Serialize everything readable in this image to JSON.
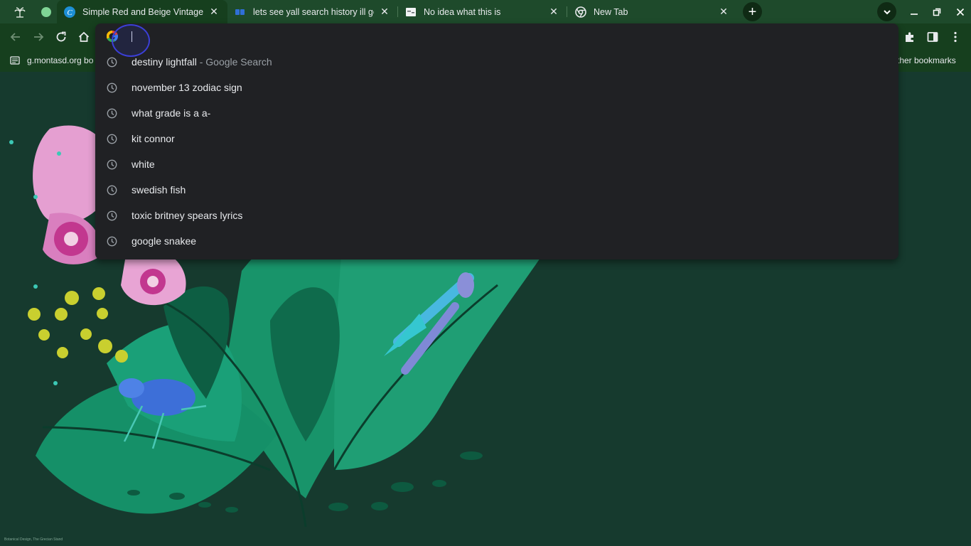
{
  "tabs": [
    {
      "title": "Simple Red and Beige Vintage Illustration",
      "active": true,
      "favicon": "canva-icon"
    },
    {
      "title": "lets see yall search history ill go",
      "active": false,
      "favicon": "doc-icon"
    },
    {
      "title": "No idea what this is",
      "active": false,
      "favicon": "page-icon"
    },
    {
      "title": "New Tab",
      "active": false,
      "favicon": "chrome-icon"
    }
  ],
  "tab_close_glyph": "✕",
  "new_tab_glyph": "+",
  "bookmarks": {
    "left_item": "g.montasd.org bo",
    "right_item": "ther bookmarks"
  },
  "omnibox": {
    "input_value": "",
    "suggestions": [
      {
        "text": "destiny lightfall",
        "sub": " - Google Search"
      },
      {
        "text": "november 13 zodiac sign",
        "sub": ""
      },
      {
        "text": "what grade is a a-",
        "sub": ""
      },
      {
        "text": "kit connor",
        "sub": ""
      },
      {
        "text": "white",
        "sub": ""
      },
      {
        "text": "swedish fish",
        "sub": ""
      },
      {
        "text": "toxic britney spears lyrics",
        "sub": ""
      },
      {
        "text": "google snakee",
        "sub": ""
      }
    ]
  },
  "colors": {
    "tabstrip": "#1e4a2b",
    "toolbar": "#163f1e",
    "dropdown": "#202124",
    "background": "#163a2e"
  },
  "attribution": "Botanical Design, The Grecian Stand"
}
